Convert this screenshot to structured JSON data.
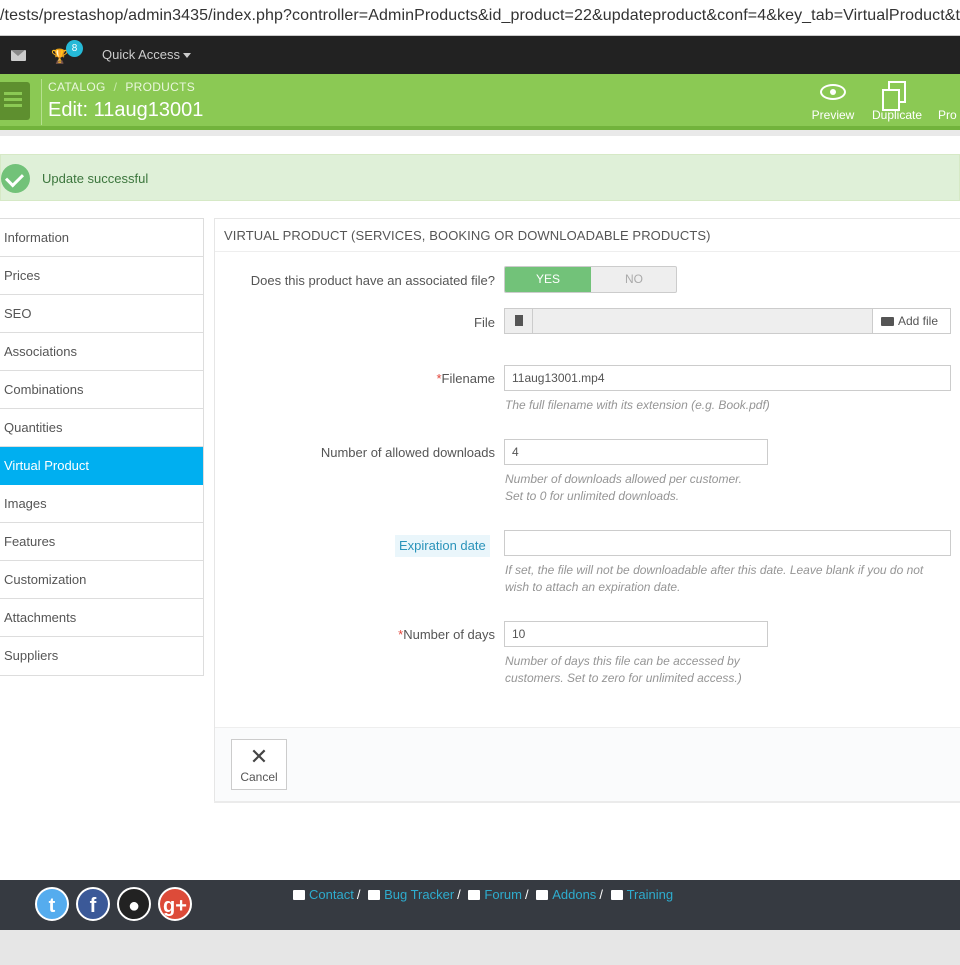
{
  "browser": {
    "url": "/tests/prestashop/admin3435/index.php?controller=AdminProducts&id_product=22&updateproduct&conf=4&key_tab=VirtualProduct&t"
  },
  "topnav": {
    "notification_count": "8",
    "quick_access": "Quick Access"
  },
  "header": {
    "breadcrumb": [
      "CATALOG",
      "PRODUCTS"
    ],
    "breadcrumb_separator": "/",
    "title": "Edit: 11aug13001",
    "buttons": {
      "preview": "Preview",
      "duplicate": "Duplicate",
      "product_sheet": "Pro"
    },
    "brand_color": "#8bc954"
  },
  "alert": {
    "message": "Update successful"
  },
  "sidebar": {
    "items": [
      "Information",
      "Prices",
      "SEO",
      "Associations",
      "Combinations",
      "Quantities",
      "Virtual Product",
      "Images",
      "Features",
      "Customization",
      "Attachments",
      "Suppliers"
    ],
    "active": "Virtual Product",
    "active_color": "#00aff0"
  },
  "panel": {
    "heading": "VIRTUAL PRODUCT (SERVICES, BOOKING OR DOWNLOADABLE PRODUCTS)",
    "associated_file": {
      "label": "Does this product have an associated file?",
      "yes": "YES",
      "no": "NO",
      "value": "YES"
    },
    "file": {
      "label": "File",
      "add_button": "Add file"
    },
    "filename": {
      "required_mark": "*",
      "label": "Filename",
      "value": "11aug13001.mp4",
      "help": "The full filename with its extension (e.g. Book.pdf)"
    },
    "downloads": {
      "label": "Number of allowed downloads",
      "value": "4",
      "help_line1": "Number of downloads allowed per customer.",
      "help_line2": "Set to 0 for unlimited downloads."
    },
    "expiration": {
      "label": "Expiration date",
      "value": "",
      "help_line1": "If set, the file will not be downloadable after this date. Leave blank if you do not",
      "help_line2": "wish to attach an expiration date."
    },
    "days": {
      "required_mark": "*",
      "label": "Number of days",
      "value": "10",
      "help_line1": "Number of days this file can be accessed by",
      "help_line2": "customers. Set to zero for unlimited access.)"
    },
    "cancel": "Cancel"
  },
  "footer": {
    "social": [
      "twitter",
      "facebook",
      "github",
      "google-plus"
    ],
    "links": {
      "contact": "Contact",
      "bug_tracker": "Bug Tracker",
      "forum": "Forum",
      "addons": "Addons",
      "training": "Training"
    },
    "separator": "/"
  }
}
